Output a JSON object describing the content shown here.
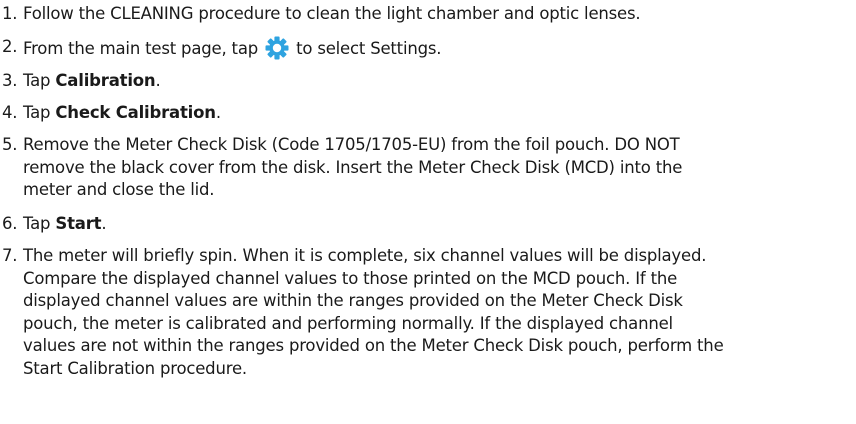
{
  "steps": [
    {
      "number": "1.",
      "text": "Follow the CLEANING procedure to clean the light chamber and optic lenses."
    },
    {
      "number": "2.",
      "text_before": "From the main test page, tap",
      "icon": "gear-icon",
      "icon_color": "#2ea3e0",
      "text_after": "to select Settings."
    },
    {
      "number": "3.",
      "prefix": "Tap ",
      "bold": "Calibration",
      "suffix": "."
    },
    {
      "number": "4.",
      "prefix": "Tap ",
      "bold": "Check Calibration",
      "suffix": "."
    },
    {
      "number": "5.",
      "lines": [
        "Remove the Meter Check Disk (Code 1705/1705-EU) from the foil pouch. DO NOT",
        "remove the black cover from the disk. Insert the Meter Check Disk (MCD) into the",
        "meter and close the lid."
      ]
    },
    {
      "number": "6.",
      "prefix": "Tap ",
      "bold": "Start",
      "suffix": "."
    },
    {
      "number": "7.",
      "lines": [
        "The meter will briefly spin. When it is complete, six channel values will be displayed.",
        "Compare the displayed channel values to those printed on the MCD pouch. If the",
        "displayed channel values are within the ranges provided on the Meter Check Disk",
        "pouch, the meter is calibrated and performing normally. If the displayed channel",
        "values are not within the ranges provided on the Meter Check Disk pouch, perform the",
        "Start Calibration procedure."
      ]
    }
  ]
}
